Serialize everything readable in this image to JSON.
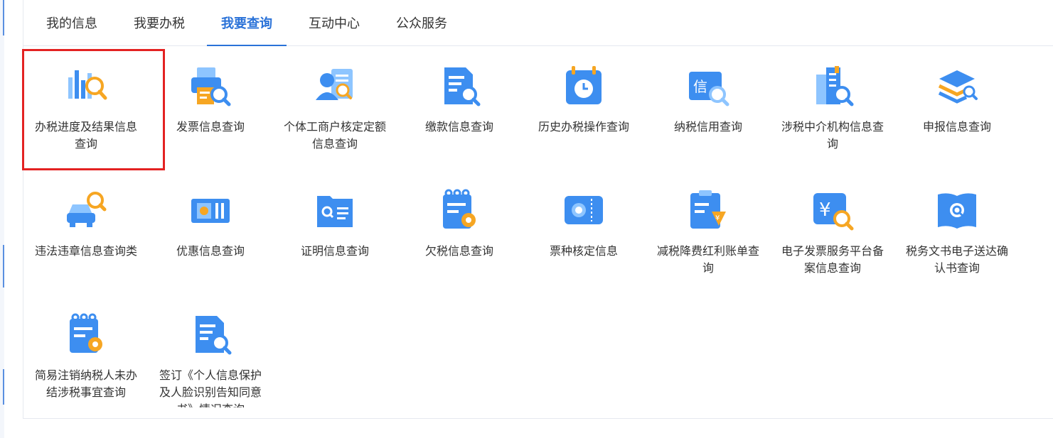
{
  "tabs": [
    {
      "label": "我的信息"
    },
    {
      "label": "我要办税"
    },
    {
      "label": "我要查询"
    },
    {
      "label": "互动中心"
    },
    {
      "label": "公众服务"
    }
  ],
  "active_tab": "我要查询",
  "items": [
    {
      "label": "办税进度及结果信息查询",
      "icon": "bar-chart-search-icon"
    },
    {
      "label": "发票信息查询",
      "icon": "printer-search-icon"
    },
    {
      "label": "个体工商户核定定额信息查询",
      "icon": "person-card-search-icon"
    },
    {
      "label": "缴款信息查询",
      "icon": "document-search-icon"
    },
    {
      "label": "历史办税操作查询",
      "icon": "calendar-history-icon"
    },
    {
      "label": "纳税信用查询",
      "icon": "credit-search-icon"
    },
    {
      "label": "涉税中介机构信息查询",
      "icon": "building-search-icon"
    },
    {
      "label": "申报信息查询",
      "icon": "layers-search-icon"
    },
    {
      "label": "违法违章信息查询类",
      "icon": "car-search-icon"
    },
    {
      "label": "优惠信息查询",
      "icon": "ticket-discount-icon"
    },
    {
      "label": "证明信息查询",
      "icon": "certificate-search-icon"
    },
    {
      "label": "欠税信息查询",
      "icon": "notepad-search-icon"
    },
    {
      "label": "票种核定信息",
      "icon": "ticket-type-icon"
    },
    {
      "label": "减税降费红利账单查询",
      "icon": "clipboard-yen-icon"
    },
    {
      "label": "电子发票服务平台备案信息查询",
      "icon": "yen-search-icon"
    },
    {
      "label": "税务文书电子送达确认书查询",
      "icon": "book-search-icon"
    },
    {
      "label": "简易注销纳税人未办结涉税事宜查询",
      "icon": "notepad-search-icon"
    },
    {
      "label": "签订《个人信息保护及人脸识别告知同意书》情况查询",
      "icon": "document-search-icon"
    }
  ],
  "colors": {
    "accent": "#2a72d8",
    "icon_blue": "#3d8ef0",
    "icon_light": "#8ec5ff",
    "icon_orange": "#f6a623",
    "highlight": "#e32222"
  }
}
